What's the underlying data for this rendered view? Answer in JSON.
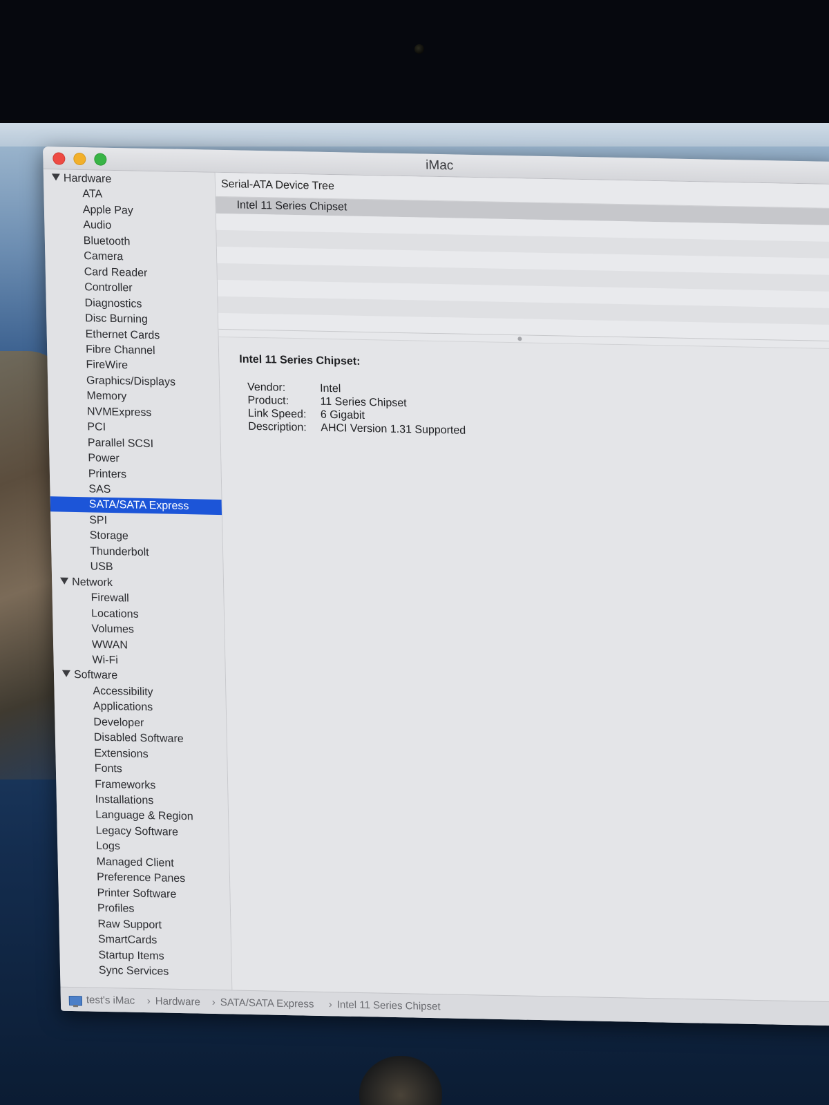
{
  "window": {
    "title": "iMac"
  },
  "sidebar": {
    "items": [
      {
        "label": "Hardware",
        "kind": "group"
      },
      {
        "label": "ATA",
        "kind": "item"
      },
      {
        "label": "Apple Pay",
        "kind": "item"
      },
      {
        "label": "Audio",
        "kind": "item"
      },
      {
        "label": "Bluetooth",
        "kind": "item"
      },
      {
        "label": "Camera",
        "kind": "item"
      },
      {
        "label": "Card Reader",
        "kind": "item"
      },
      {
        "label": "Controller",
        "kind": "item"
      },
      {
        "label": "Diagnostics",
        "kind": "item"
      },
      {
        "label": "Disc Burning",
        "kind": "item"
      },
      {
        "label": "Ethernet Cards",
        "kind": "item"
      },
      {
        "label": "Fibre Channel",
        "kind": "item"
      },
      {
        "label": "FireWire",
        "kind": "item"
      },
      {
        "label": "Graphics/Displays",
        "kind": "item"
      },
      {
        "label": "Memory",
        "kind": "item"
      },
      {
        "label": "NVMExpress",
        "kind": "item"
      },
      {
        "label": "PCI",
        "kind": "item"
      },
      {
        "label": "Parallel SCSI",
        "kind": "item"
      },
      {
        "label": "Power",
        "kind": "item"
      },
      {
        "label": "Printers",
        "kind": "item"
      },
      {
        "label": "SAS",
        "kind": "item"
      },
      {
        "label": "SATA/SATA Express",
        "kind": "item",
        "selected": true
      },
      {
        "label": "SPI",
        "kind": "item"
      },
      {
        "label": "Storage",
        "kind": "item"
      },
      {
        "label": "Thunderbolt",
        "kind": "item"
      },
      {
        "label": "USB",
        "kind": "item"
      },
      {
        "label": "Network",
        "kind": "group"
      },
      {
        "label": "Firewall",
        "kind": "item"
      },
      {
        "label": "Locations",
        "kind": "item"
      },
      {
        "label": "Volumes",
        "kind": "item"
      },
      {
        "label": "WWAN",
        "kind": "item"
      },
      {
        "label": "Wi-Fi",
        "kind": "item"
      },
      {
        "label": "Software",
        "kind": "group"
      },
      {
        "label": "Accessibility",
        "kind": "item"
      },
      {
        "label": "Applications",
        "kind": "item"
      },
      {
        "label": "Developer",
        "kind": "item"
      },
      {
        "label": "Disabled Software",
        "kind": "item"
      },
      {
        "label": "Extensions",
        "kind": "item"
      },
      {
        "label": "Fonts",
        "kind": "item"
      },
      {
        "label": "Frameworks",
        "kind": "item"
      },
      {
        "label": "Installations",
        "kind": "item"
      },
      {
        "label": "Language & Region",
        "kind": "item"
      },
      {
        "label": "Legacy Software",
        "kind": "item"
      },
      {
        "label": "Logs",
        "kind": "item"
      },
      {
        "label": "Managed Client",
        "kind": "item"
      },
      {
        "label": "Preference Panes",
        "kind": "item"
      },
      {
        "label": "Printer Software",
        "kind": "item"
      },
      {
        "label": "Profiles",
        "kind": "item"
      },
      {
        "label": "Raw Support",
        "kind": "item"
      },
      {
        "label": "SmartCards",
        "kind": "item"
      },
      {
        "label": "Startup Items",
        "kind": "item"
      },
      {
        "label": "Sync Services",
        "kind": "item"
      }
    ]
  },
  "tree": {
    "header": "Serial-ATA Device Tree",
    "rows": [
      "Intel 11 Series Chipset"
    ]
  },
  "detail": {
    "heading": "Intel 11 Series Chipset:",
    "properties": [
      {
        "key": "Vendor:",
        "value": "Intel"
      },
      {
        "key": "Product:",
        "value": "11 Series Chipset"
      },
      {
        "key": "Link Speed:",
        "value": "6 Gigabit"
      },
      {
        "key": "Description:",
        "value": "AHCI Version 1.31 Supported"
      }
    ]
  },
  "statusbar": {
    "path": [
      "test's iMac",
      "Hardware",
      "SATA/SATA Express",
      "Intel 11 Series Chipset"
    ],
    "separator": "›"
  },
  "colors": {
    "selection": "#1c55d8",
    "close": "#ee4a43",
    "minimize": "#f2b02b",
    "zoom": "#38b446"
  }
}
